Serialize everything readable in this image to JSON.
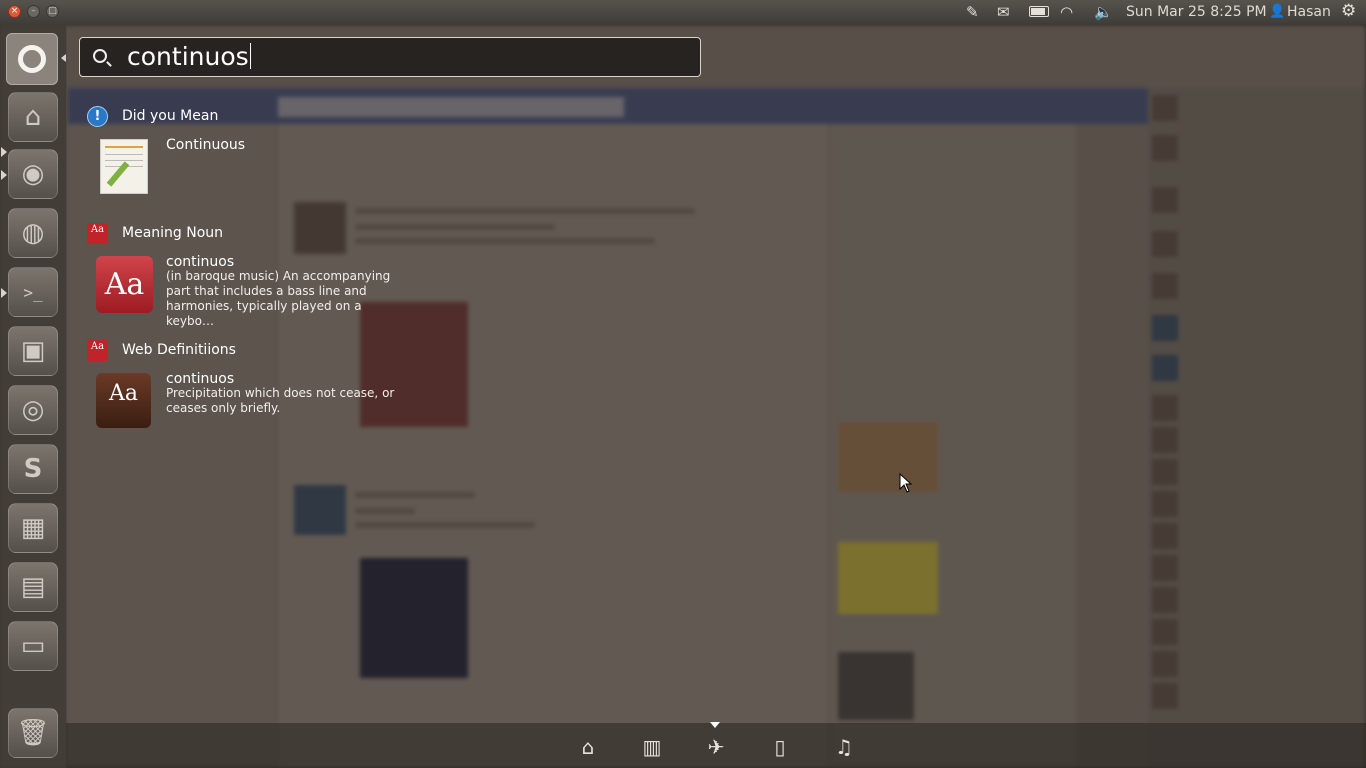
{
  "panel": {
    "datetime": "Sun Mar 25  8:25 PM",
    "user": "Hasan",
    "window_buttons": [
      "×",
      "–",
      "□"
    ],
    "icons": [
      "edit-icon",
      "mail-icon",
      "battery-icon",
      "wifi-icon",
      "volume-icon",
      "user-icon",
      "gear-icon"
    ]
  },
  "launcher": {
    "items": [
      "home-folder",
      "chromium",
      "firefox",
      "terminal",
      "software-center",
      "thunderbird",
      "skype",
      "workspace-switcher",
      "window-spread",
      "drive",
      "trash"
    ]
  },
  "search": {
    "query": "continuos"
  },
  "results": {
    "did_you_mean": {
      "title": "Did you Mean",
      "item": "Continuous"
    },
    "meaning": {
      "title": "Meaning Noun",
      "word": "continuos",
      "description": "(in baroque music) An accompanying part that includes a bass line and harmonies, typically played on a keybo…"
    },
    "web": {
      "title": "Web Definitiions",
      "word": "continuos",
      "description": "Precipitation which does not cease, or ceases only briefly."
    },
    "dict_glyph": "Aa"
  },
  "lenses": [
    "home-lens",
    "applications-lens",
    "dictionary-lens",
    "files-lens",
    "music-lens"
  ],
  "colors": {
    "accent": "#c0232a",
    "info": "#2a78c8"
  }
}
